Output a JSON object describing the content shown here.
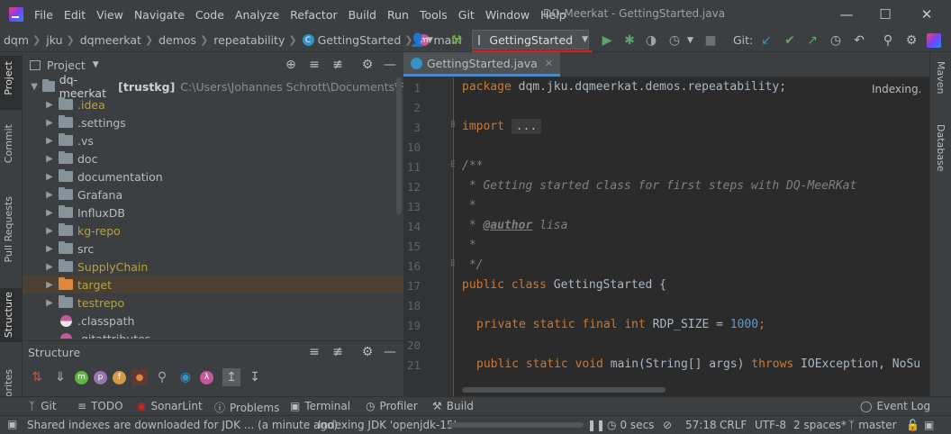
{
  "window": {
    "title": "DQ-Meerkat - GettingStarted.java",
    "menu": [
      "File",
      "Edit",
      "View",
      "Navigate",
      "Code",
      "Analyze",
      "Refactor",
      "Build",
      "Run",
      "Tools",
      "Git",
      "Window",
      "Help"
    ]
  },
  "breadcrumbs": [
    "dqm",
    "jku",
    "dqmeerkat",
    "demos",
    "repeatability",
    "GettingStarted",
    "main"
  ],
  "toolbar": {
    "run_config": "GettingStarted",
    "git_label": "Git:"
  },
  "left_strip": [
    "Project",
    "Commit",
    "Pull Requests",
    "Structure",
    "orites"
  ],
  "right_strip": [
    "Maven",
    "Database"
  ],
  "project_panel": {
    "title": "Project",
    "root": {
      "name": "dq-meerkat",
      "module": "[trustkg]",
      "path": "C:\\Users\\Johannes Schrott\\Documents\\FAW\\dq-"
    },
    "items": [
      {
        "name": ".idea",
        "color": "#b3a343"
      },
      {
        "name": ".settings",
        "color": "#bbbbbb"
      },
      {
        "name": ".vs",
        "color": "#bbbbbb"
      },
      {
        "name": "doc",
        "color": "#bbbbbb"
      },
      {
        "name": "documentation",
        "color": "#bbbbbb"
      },
      {
        "name": "Grafana",
        "color": "#bbbbbb"
      },
      {
        "name": "InfluxDB",
        "color": "#bbbbbb"
      },
      {
        "name": "kg-repo",
        "color": "#b3a343"
      },
      {
        "name": "src",
        "color": "#bbbbbb"
      },
      {
        "name": "SupplyChain",
        "color": "#b3a343"
      },
      {
        "name": "target",
        "color": "#b3a343"
      },
      {
        "name": "testrepo",
        "color": "#b3a343"
      },
      {
        "name": ".classpath",
        "color": "#bbbbbb"
      },
      {
        "name": ".gitattributes",
        "color": "#bbbbbb"
      }
    ]
  },
  "structure_panel": {
    "title": "Structure"
  },
  "editor": {
    "tab": "GettingStarted.java",
    "indexing": "Indexing...",
    "line_numbers": [
      "1",
      "2",
      "3",
      "10",
      "11",
      "12",
      "13",
      "14",
      "15",
      "16",
      "17",
      "18",
      "19",
      "20",
      "21"
    ],
    "lines": {
      "l1_kw": "package",
      "l1_rest": " dqm.jku.dqmeerkat.demos.repeatability;",
      "l3_kw": "import",
      "l3_fold": "...",
      "l11": "/**",
      "l12": " * Getting started class for first steps with DQ-MeeRKat",
      "l13": " *",
      "l14_pre": " * ",
      "l14_tag": "@author",
      "l14_post": " lisa",
      "l15": " *",
      "l16": " */",
      "l17_kw": "public class",
      "l17_rest": " GettingStarted {",
      "l19_kw": "private static final int",
      "l19_rest": " RDP_SIZE = ",
      "l19_num": "1000",
      "l19_end": ";",
      "l21_kw1": "public static void",
      "l21_mid": " main(String[] args) ",
      "l21_kw2": "throws",
      "l21_rest": " IOException, NoSu"
    }
  },
  "tool_windows": [
    "Git",
    "TODO",
    "SonarLint",
    "Problems",
    "Terminal",
    "Profiler",
    "Build"
  ],
  "event_log": "Event Log",
  "status": {
    "message": "Shared indexes are downloaded for JDK ... (a minute ago)",
    "indexing": "Indexing JDK 'openjdk-15'",
    "timer": "0 secs",
    "position": "57:18",
    "line_sep": "CRLF",
    "encoding": "UTF-8",
    "indent": "2 spaces*",
    "branch": "master"
  }
}
